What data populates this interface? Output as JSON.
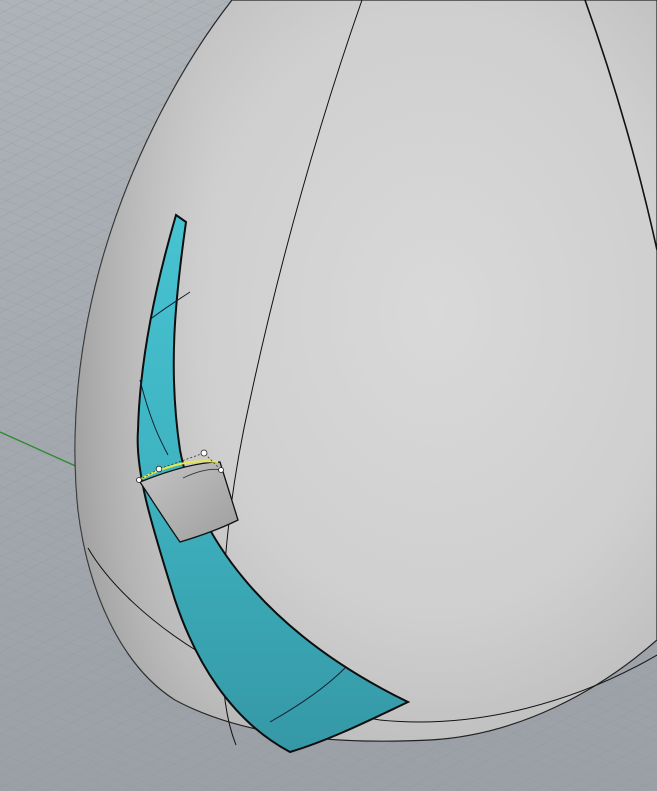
{
  "viewport": {
    "view_mode": "perspective-shaded",
    "background_color": "#a1a7ad",
    "grid_color": "#8f959b",
    "grid_axis_color": "#2f8a32"
  },
  "model": {
    "body_color": "#d2d2d2",
    "selected_surface_color": "#3fb6c4",
    "patch_surface_color": "#b4b4b4",
    "edge_color": "#111111",
    "highlight_curve_color": "#e8e84a",
    "control_point_color": "#ffffff"
  },
  "icons": {
    "control_point": "circle-handle-icon"
  }
}
